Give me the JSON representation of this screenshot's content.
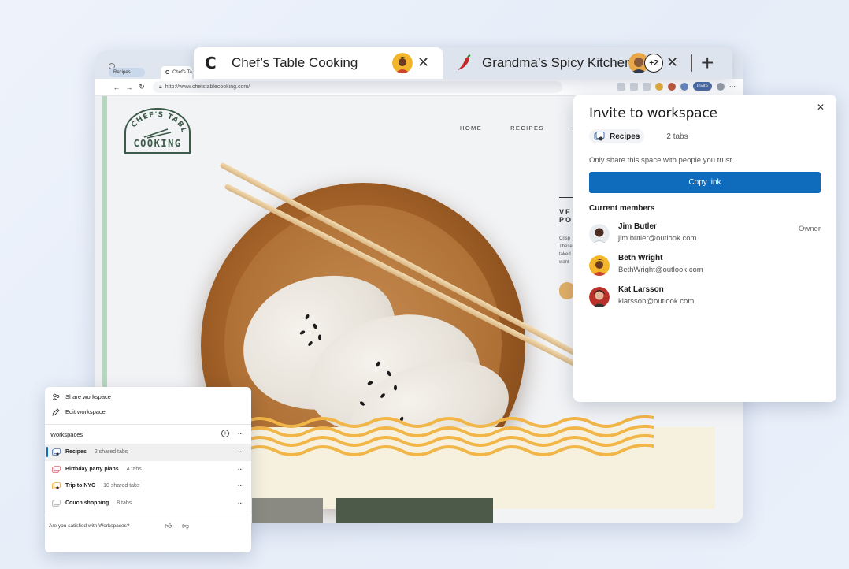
{
  "browser": {
    "mini_tabs": [
      {
        "label": "Recipes"
      },
      {
        "label": "Chef's Ta"
      }
    ],
    "url": "http://www.chefstablecooking.com/",
    "invite_pill": "Invite"
  },
  "site": {
    "logo_line1": "CHEF'S TABLE",
    "logo_line2": "COOKING",
    "nav": [
      "HOME",
      "RECIPES",
      "AB"
    ],
    "hero_title_1": "VE",
    "hero_title_2": "PO",
    "hero_text": [
      "Crisp",
      "These",
      "taked",
      "want"
    ]
  },
  "tabs": {
    "active": {
      "favicon": "C",
      "title": "Chef’s Table Cooking"
    },
    "inactive": {
      "title": "Grandma’s Spicy Kitchen",
      "extra_count": "+2"
    }
  },
  "invite": {
    "title": "Invite to workspace",
    "workspace_name": "Recipes",
    "workspace_tabs": "2 tabs",
    "trust_note": "Only share this space with people you trust.",
    "copy_link": "Copy link",
    "members_title": "Current members",
    "members": [
      {
        "name": "Jim Butler",
        "email": "jim.butler@outlook.com",
        "role": "Owner"
      },
      {
        "name": "Beth Wright",
        "email": "BethWright@outlook.com",
        "role": ""
      },
      {
        "name": "Kat Larsson",
        "email": "klarsson@outlook.com",
        "role": ""
      }
    ]
  },
  "workspaces_panel": {
    "share": "Share workspace",
    "edit": "Edit workspace",
    "header": "Workspaces",
    "items": [
      {
        "name": "Recipes",
        "count": "2 shared tabs",
        "icon_color": "#4c6ea8"
      },
      {
        "name": "Birthday party plans",
        "count": "4 tabs",
        "icon_color": "#e06a7a"
      },
      {
        "name": "Trip to NYC",
        "count": "10 shared tabs",
        "icon_color": "#e8a33a"
      },
      {
        "name": "Couch shopping",
        "count": "8 tabs",
        "icon_color": "#b0b0b0"
      }
    ],
    "feedback": "Are you satisfied with Workspaces?"
  },
  "colors": {
    "accent": "#0f6cbd",
    "page_accent_green": "#b7d6bf"
  },
  "icons": [
    "close-icon",
    "new-tab-icon",
    "share-icon",
    "edit-icon",
    "add-icon",
    "more-icon",
    "thumbs-up-icon",
    "thumbs-down-icon",
    "workspace-icon",
    "chili-icon"
  ]
}
